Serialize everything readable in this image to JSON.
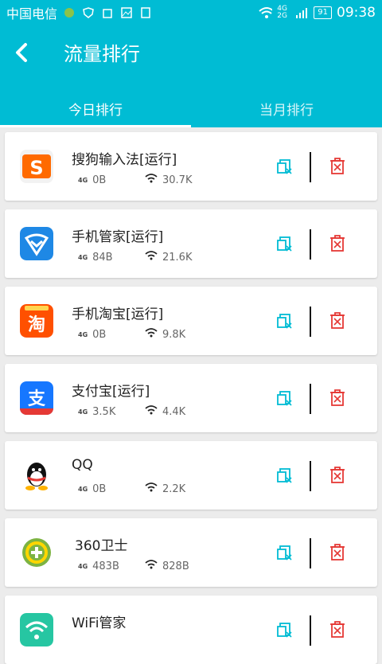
{
  "status_bar": {
    "carrier": "中国电信",
    "network": "4G 2G",
    "battery": "91",
    "time": "09:38"
  },
  "header": {
    "title": "流量排行"
  },
  "tabs": [
    {
      "label": "今日排行",
      "active": true
    },
    {
      "label": "当月排行",
      "active": false
    }
  ],
  "apps": [
    {
      "name": "搜狗输入法[运行]",
      "cell": "0B",
      "wifi": "30.7K",
      "icon": "sogou-icon"
    },
    {
      "name": "手机管家[运行]",
      "cell": "84B",
      "wifi": "21.6K",
      "icon": "tencent-manager-icon"
    },
    {
      "name": "手机淘宝[运行]",
      "cell": "0B",
      "wifi": "9.8K",
      "icon": "taobao-icon"
    },
    {
      "name": "支付宝[运行]",
      "cell": "3.5K",
      "wifi": "4.4K",
      "icon": "alipay-icon"
    },
    {
      "name": "QQ",
      "cell": "0B",
      "wifi": "2.2K",
      "icon": "qq-icon"
    },
    {
      "name": "360卫士",
      "cell": "483B",
      "wifi": "828B",
      "icon": "360-guard-icon"
    },
    {
      "name": "WiFi管家",
      "cell": "",
      "wifi": "",
      "icon": "wifi-manager-icon"
    }
  ],
  "labels": {
    "cell_tag": "4G"
  },
  "colors": {
    "primary": "#00bcd4",
    "stop": "#00bcd4",
    "delete": "#e53935"
  }
}
